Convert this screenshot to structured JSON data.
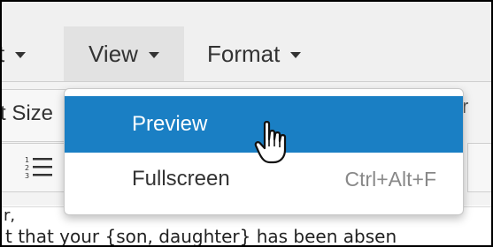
{
  "menubar": {
    "items": [
      {
        "label": "t"
      },
      {
        "label": "View"
      },
      {
        "label": "Format"
      }
    ]
  },
  "toolbar": {
    "font_size_label": "t Size",
    "right_fragment": "r"
  },
  "view_menu": {
    "items": [
      {
        "label": "Preview",
        "shortcut": "",
        "state": "hovered"
      },
      {
        "label": "Fullscreen",
        "shortcut": "Ctrl+Alt+F"
      }
    ]
  },
  "editor": {
    "line1": "r,",
    "line2": "t that your {son, daughter} has been absen"
  },
  "colors": {
    "highlight": "#1a7fc4",
    "menubar_bg": "#f0f0f0",
    "active_menu_bg": "#e2e2e2"
  },
  "icons": [
    "caret-down-icon",
    "numbered-list-icon",
    "hand-pointer-cursor-icon"
  ]
}
